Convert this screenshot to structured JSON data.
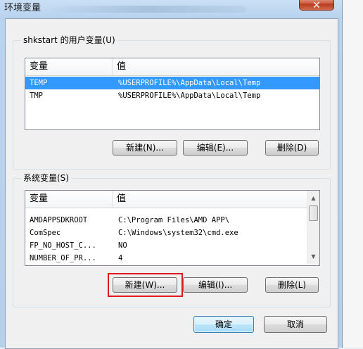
{
  "window": {
    "title": "环境变量",
    "close_label": "✕"
  },
  "user_vars": {
    "group_label": "shkstart 的用户变量(U)",
    "col_name": "变量",
    "col_value": "值",
    "rows": [
      {
        "name": "TEMP",
        "value": "%USERPROFILE%\\AppData\\Local\\Temp",
        "selected": true
      },
      {
        "name": "TMP",
        "value": "%USERPROFILE%\\AppData\\Local\\Temp",
        "selected": false
      }
    ],
    "new_label": "新建(N)...",
    "edit_label": "编辑(E)...",
    "delete_label": "删除(D)"
  },
  "system_vars": {
    "group_label": "系统变量(S)",
    "col_name": "变量",
    "col_value": "值",
    "rows": [
      {
        "name": "AMDAPPSDKROOT",
        "value": "C:\\Program Files\\AMD APP\\"
      },
      {
        "name": "ComSpec",
        "value": "C:\\Windows\\system32\\cmd.exe"
      },
      {
        "name": "FP_NO_HOST_C...",
        "value": "NO"
      },
      {
        "name": "NUMBER_OF_PR...",
        "value": "4"
      }
    ],
    "new_label": "新建(W)...",
    "edit_label": "编辑(I)...",
    "delete_label": "删除(L)",
    "scroll_up_icon": "▲",
    "scroll_down_icon": "▼"
  },
  "dialog": {
    "ok_label": "确定",
    "cancel_label": "取消"
  },
  "colors": {
    "selection": "#3399ff",
    "highlight_box": "#e0191f"
  }
}
